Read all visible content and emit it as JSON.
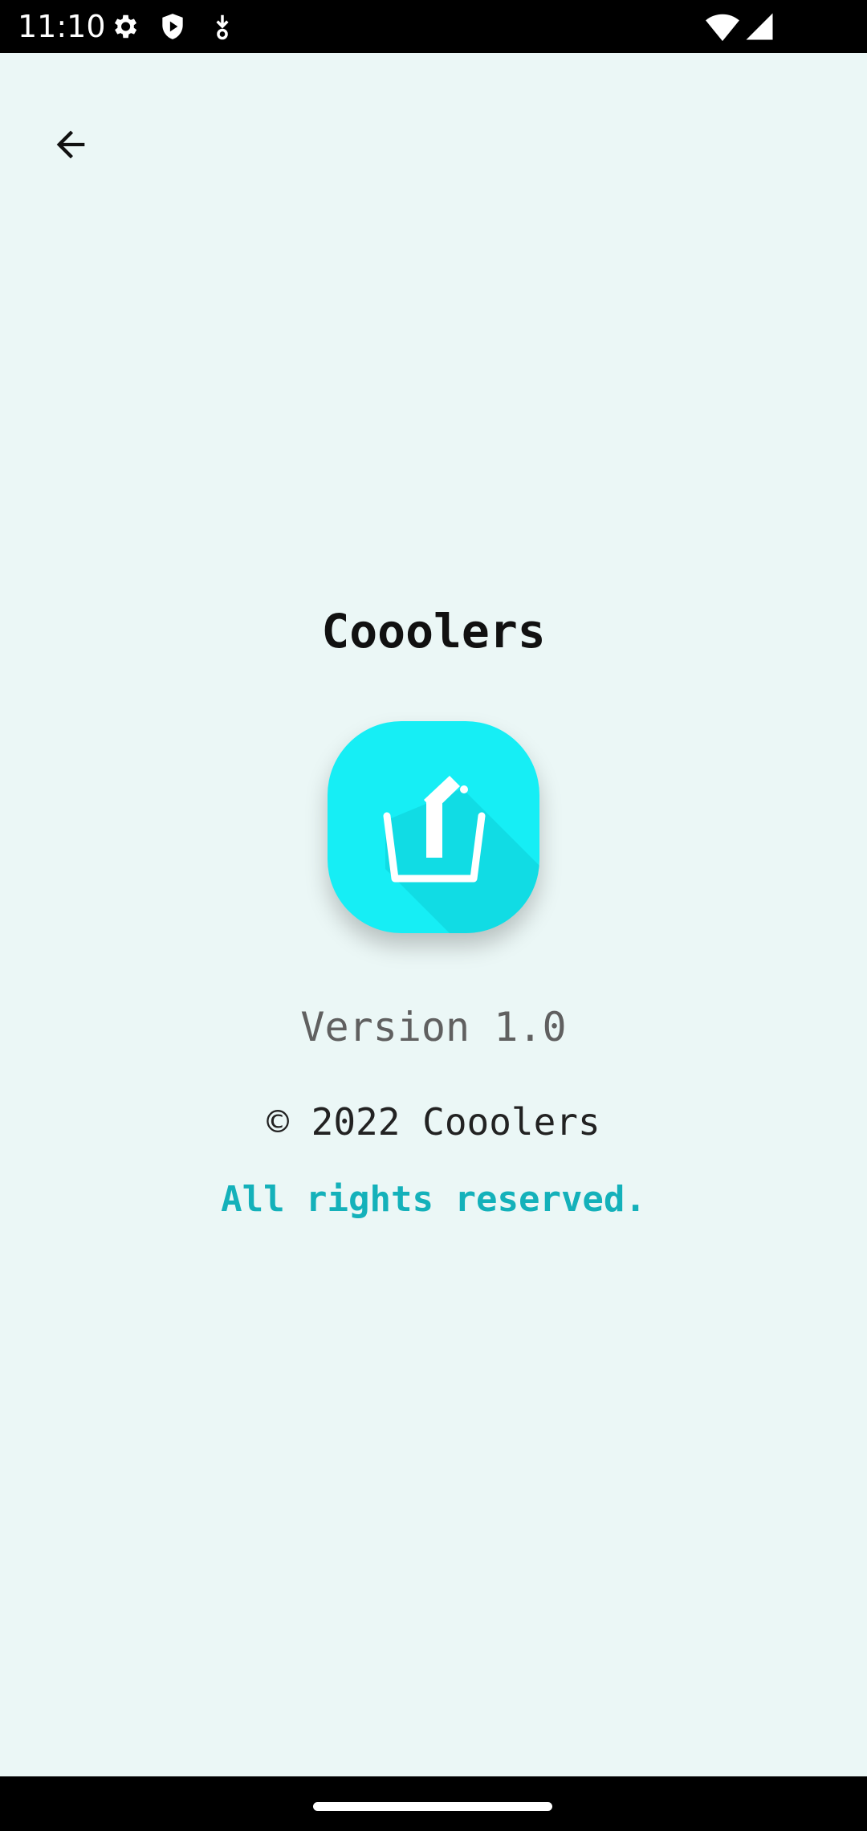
{
  "status_bar": {
    "time": "11:10",
    "icons": [
      "gear-icon",
      "shield-play-icon",
      "download-icon",
      "wifi-icon",
      "signal-icon"
    ]
  },
  "app_bar": {
    "back_icon": "arrow-back-icon"
  },
  "about": {
    "app_name": "Cooolers",
    "logo_icon": "glass-with-straw-icon",
    "version": "Version 1.0",
    "copyright": "© 2022 Cooolers",
    "rights": "All rights reserved."
  },
  "colors": {
    "background": "#ebf7f6",
    "accent": "#16eef5",
    "rights_text": "#14b1ba"
  }
}
